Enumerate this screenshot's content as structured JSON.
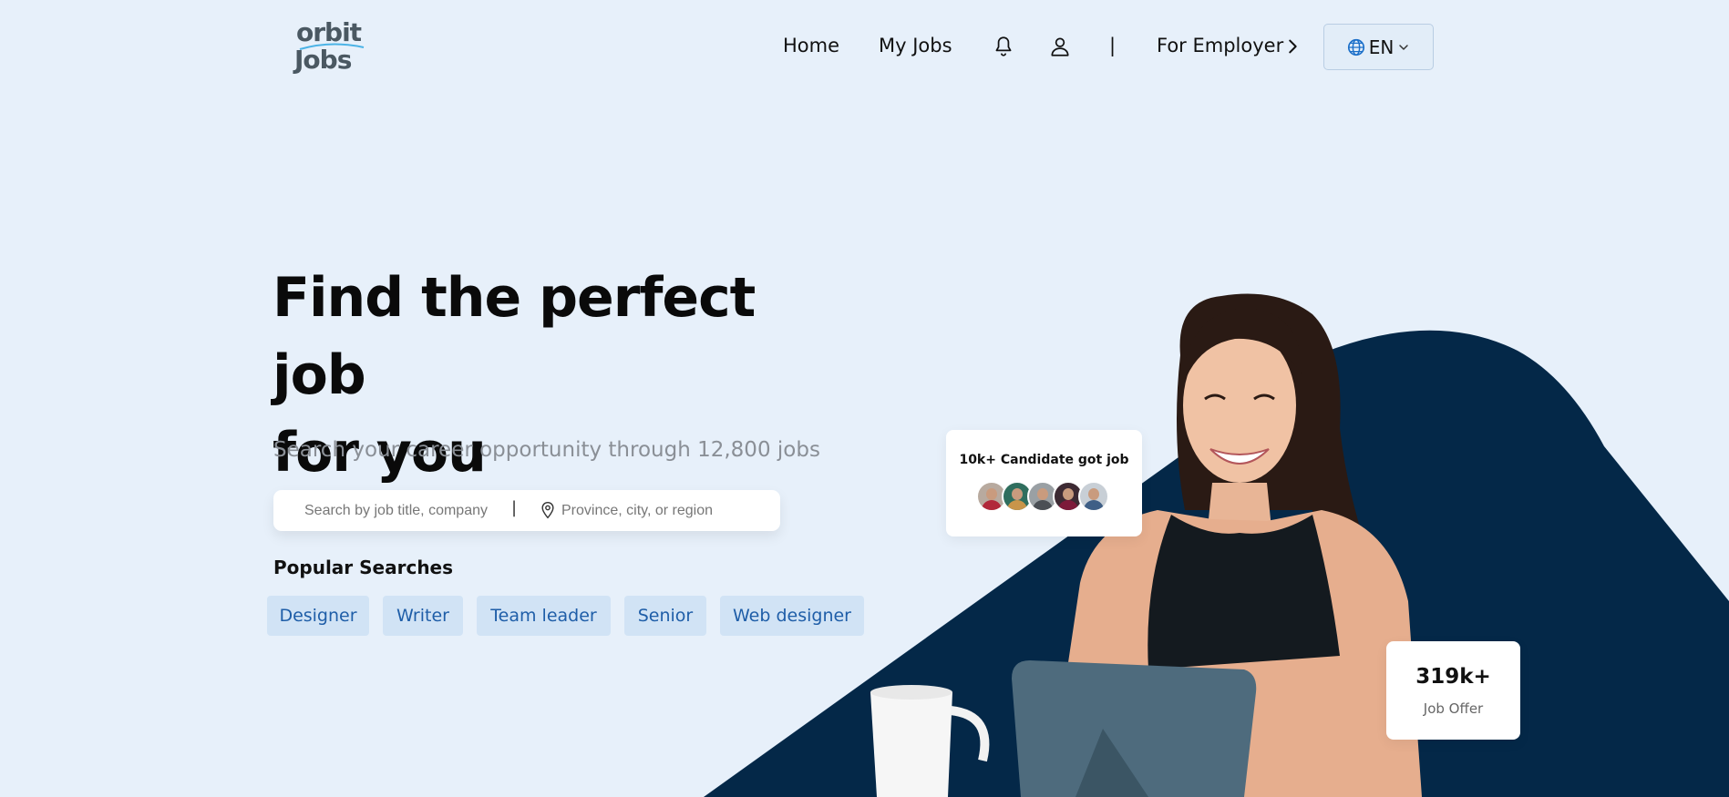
{
  "brand": {
    "logo_line1": "orbit",
    "logo_line2": "Jobs"
  },
  "nav": {
    "home": "Home",
    "my_jobs": "My Jobs",
    "separator": "|",
    "for_employer": "For Employer",
    "language": "EN"
  },
  "hero": {
    "title_line1": "Find the perfect job",
    "title_line2": "for you",
    "subtitle": "Search your career opportunity through 12,800 jobs"
  },
  "search": {
    "query_placeholder": "Search by job title, company",
    "query_value": "",
    "separator": "|",
    "location_placeholder": "Province, city, or region",
    "location_value": ""
  },
  "popular": {
    "title": "Popular Searches",
    "chips": [
      "Designer",
      "Writer",
      "Team leader",
      "Senior",
      "Web designer"
    ]
  },
  "stats": {
    "candidates_label": "10k+ Candidate got job",
    "offers_count": "319k+",
    "offers_label": "Job Offer"
  },
  "colors": {
    "background": "#e7f0fa",
    "navy_shape": "#042848",
    "chip_bg": "#d1e3f5",
    "chip_text": "#1f5ea8",
    "logo_accent": "#4bb3e6",
    "globe_icon": "#1b6fc9"
  },
  "icons": [
    "bell-icon",
    "user-icon",
    "chevron-right-icon",
    "globe-icon",
    "chevron-down-icon",
    "location-pin-icon"
  ]
}
